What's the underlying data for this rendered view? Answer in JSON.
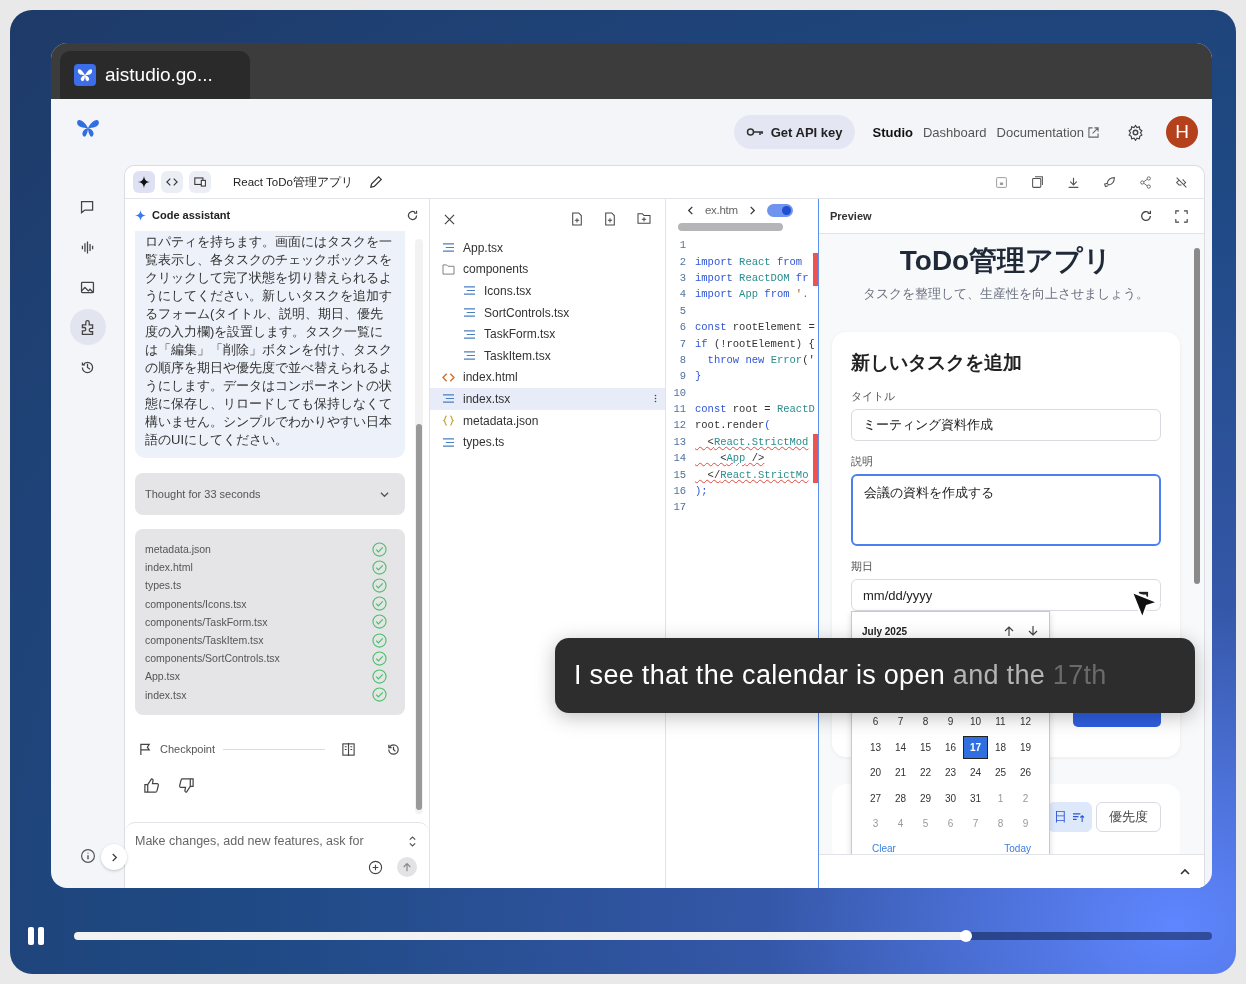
{
  "player": {
    "playing": true,
    "level": 0.784
  },
  "browser_tab": {
    "title": "aistudio.go..."
  },
  "header": {
    "api_key_button": "Get API key",
    "nav": [
      {
        "label": "Studio",
        "selected": true,
        "external": false
      },
      {
        "label": "Dashboard",
        "selected": false,
        "external": false
      },
      {
        "label": "Documentation",
        "selected": false,
        "external": true
      }
    ],
    "avatar": "H"
  },
  "rail": {
    "items": [
      {
        "kind": "chat",
        "selected": false
      },
      {
        "kind": "audio",
        "selected": false
      },
      {
        "kind": "image",
        "selected": false
      },
      {
        "kind": "build",
        "selected": true
      },
      {
        "kind": "history",
        "selected": false
      }
    ]
  },
  "project": {
    "title": "React ToDo管理アプリ",
    "modes": [
      {
        "kind": "assistant",
        "selected": true
      },
      {
        "kind": "code",
        "selected": false
      },
      {
        "kind": "device",
        "selected": false
      }
    ]
  },
  "chat": {
    "title": "Code assistant",
    "message": "ロパティを持ちます。画面にはタスクを一覧表示し、各タスクのチェックボックスをクリックして完了状態を切り替えられるようにしてください。新しいタスクを追加するフォーム(タイトル、説明、期日、優先度の入力欄)を設置します。タスク一覧には「編集」「削除」ボタンを付け、タスクの順序を期日や優先度で並べ替えられるようにします。データはコンポーネントの状態に保存し、リロードしても保持しなくて構いません。シンプルでわかりやすい日本語のUIにしてください。",
    "thought": {
      "label": "Thought for 33 seconds",
      "expanded": false
    },
    "files": [
      {
        "name": "metadata.json",
        "done": true
      },
      {
        "name": "index.html",
        "done": true
      },
      {
        "name": "types.ts",
        "done": true
      },
      {
        "name": "components/Icons.tsx",
        "done": true
      },
      {
        "name": "components/TaskForm.tsx",
        "done": true
      },
      {
        "name": "components/TaskItem.tsx",
        "done": true
      },
      {
        "name": "components/SortControls.tsx",
        "done": true
      },
      {
        "name": "App.tsx",
        "done": true
      },
      {
        "name": "index.tsx",
        "done": true
      }
    ],
    "checkpoint": "Checkpoint",
    "input": {
      "placeholder": "Make changes, add new features, ask for"
    }
  },
  "files": {
    "tree": [
      {
        "name": "App.tsx",
        "kind": "code",
        "selected": false
      },
      {
        "name": "components",
        "kind": "folder",
        "selected": false,
        "children": [
          {
            "name": "Icons.tsx",
            "kind": "code",
            "selected": false
          },
          {
            "name": "SortControls.tsx",
            "kind": "code",
            "selected": false
          },
          {
            "name": "TaskForm.tsx",
            "kind": "code",
            "selected": false
          },
          {
            "name": "TaskItem.tsx",
            "kind": "code",
            "selected": false
          }
        ]
      },
      {
        "name": "index.html",
        "kind": "html",
        "selected": false
      },
      {
        "name": "index.tsx",
        "kind": "code",
        "selected": true
      },
      {
        "name": "metadata.json",
        "kind": "json",
        "selected": false
      },
      {
        "name": "types.ts",
        "kind": "code",
        "selected": false
      }
    ]
  },
  "editor": {
    "tab": "ex.htm",
    "toggle_on": true,
    "lines": [
      {
        "number": "1"
      },
      {
        "number": "2",
        "marker": true,
        "tokens": [
          {
            "t": "import",
            "kind": "keyword"
          },
          {
            "t": " React ",
            "kind": "name"
          },
          {
            "t": "from",
            "kind": "keyword"
          }
        ]
      },
      {
        "number": "3",
        "marker": true,
        "tokens": [
          {
            "t": "import",
            "kind": "keyword"
          },
          {
            "t": " ReactDOM ",
            "kind": "name"
          },
          {
            "t": "fr",
            "kind": "keyword"
          }
        ]
      },
      {
        "number": "4",
        "tokens": [
          {
            "t": "import",
            "kind": "keyword"
          },
          {
            "t": " App ",
            "kind": "name"
          },
          {
            "t": "from",
            "kind": "keyword"
          },
          {
            "t": " '.",
            "kind": "string"
          }
        ]
      },
      {
        "number": "5"
      },
      {
        "number": "6",
        "tokens": [
          {
            "t": "const",
            "kind": "keyword"
          },
          {
            "t": " rootElement =",
            "kind": "plain"
          }
        ]
      },
      {
        "number": "7",
        "tokens": [
          {
            "t": "if",
            "kind": "keyword"
          },
          {
            "t": " (!rootElement) {",
            "kind": "plain"
          }
        ]
      },
      {
        "number": "8",
        "tokens": [
          {
            "t": "  throw new ",
            "kind": "keyword"
          },
          {
            "t": "Error",
            "kind": "name"
          },
          {
            "t": "('",
            "kind": "plain"
          }
        ]
      },
      {
        "number": "9",
        "tokens": [
          {
            "t": "}",
            "kind": "keyword"
          }
        ]
      },
      {
        "number": "10"
      },
      {
        "number": "11",
        "tokens": [
          {
            "t": "const",
            "kind": "keyword"
          },
          {
            "t": " root = ",
            "kind": "plain"
          },
          {
            "t": "ReactD",
            "kind": "name"
          }
        ]
      },
      {
        "number": "12",
        "tokens": [
          {
            "t": "root.render",
            "kind": "plain"
          },
          {
            "t": "(",
            "kind": "keyword"
          }
        ]
      },
      {
        "number": "13",
        "marker": true,
        "squiggle": true,
        "tokens": [
          {
            "t": "  <",
            "kind": "plain"
          },
          {
            "t": "React.StrictMod",
            "kind": "name"
          }
        ]
      },
      {
        "number": "14",
        "marker": true,
        "squiggle": true,
        "tokens": [
          {
            "t": "    <",
            "kind": "plain"
          },
          {
            "t": "App",
            "kind": "name"
          },
          {
            "t": " />",
            "kind": "plain"
          }
        ]
      },
      {
        "number": "15",
        "marker": true,
        "squiggle": true,
        "tokens": [
          {
            "t": "  </",
            "kind": "plain"
          },
          {
            "t": "React.StrictMo",
            "kind": "name"
          }
        ]
      },
      {
        "number": "16",
        "tokens": [
          {
            "t": ");",
            "kind": "keyword"
          }
        ]
      },
      {
        "number": "17"
      }
    ]
  },
  "preview": {
    "title": "Preview",
    "app_title": "ToDo管理アプリ",
    "subtitle": "タスクを整理して、生産性を向上させましょう。",
    "form": {
      "heading": "新しいタスクを追加",
      "fields": [
        {
          "label": "タイトル",
          "kind": "text",
          "value": "ミーティング資料作成",
          "focused": false
        },
        {
          "label": "説明",
          "kind": "textarea",
          "value": "会議の資料を作成する",
          "focused": true
        },
        {
          "label": "期日",
          "kind": "date",
          "placeholder": "mm/dd/yyyy",
          "focused": false
        }
      ]
    },
    "sort_buttons": [
      {
        "label": "日",
        "selected": true
      },
      {
        "label": "優先度",
        "selected": false
      }
    ],
    "calendar": {
      "month": "July 2025",
      "weeks": [
        [
          {
            "day": "6",
            "outside": false,
            "selected": false
          },
          {
            "day": "7",
            "outside": false,
            "selected": false
          },
          {
            "day": "8",
            "outside": false,
            "selected": false
          },
          {
            "day": "9",
            "outside": false,
            "selected": false
          },
          {
            "day": "10",
            "outside": false,
            "selected": false
          },
          {
            "day": "11",
            "outside": false,
            "selected": false
          },
          {
            "day": "12",
            "outside": false,
            "selected": false
          }
        ],
        [
          {
            "day": "13",
            "outside": false,
            "selected": false
          },
          {
            "day": "14",
            "outside": false,
            "selected": false
          },
          {
            "day": "15",
            "outside": false,
            "selected": false
          },
          {
            "day": "16",
            "outside": false,
            "selected": false
          },
          {
            "day": "17",
            "outside": false,
            "selected": true
          },
          {
            "day": "18",
            "outside": false,
            "selected": false
          },
          {
            "day": "19",
            "outside": false,
            "selected": false
          }
        ],
        [
          {
            "day": "20",
            "outside": false,
            "selected": false
          },
          {
            "day": "21",
            "outside": false,
            "selected": false
          },
          {
            "day": "22",
            "outside": false,
            "selected": false
          },
          {
            "day": "23",
            "outside": false,
            "selected": false
          },
          {
            "day": "24",
            "outside": false,
            "selected": false
          },
          {
            "day": "25",
            "outside": false,
            "selected": false
          },
          {
            "day": "26",
            "outside": false,
            "selected": false
          }
        ],
        [
          {
            "day": "27",
            "outside": false,
            "selected": false
          },
          {
            "day": "28",
            "outside": false,
            "selected": false
          },
          {
            "day": "29",
            "outside": false,
            "selected": false
          },
          {
            "day": "30",
            "outside": false,
            "selected": false
          },
          {
            "day": "31",
            "outside": false,
            "selected": false
          },
          {
            "day": "1",
            "outside": true,
            "selected": false
          },
          {
            "day": "2",
            "outside": true,
            "selected": false
          }
        ],
        [
          {
            "day": "3",
            "outside": true,
            "selected": false
          },
          {
            "day": "4",
            "outside": true,
            "selected": false
          },
          {
            "day": "5",
            "outside": true,
            "selected": false
          },
          {
            "day": "6",
            "outside": true,
            "selected": false
          },
          {
            "day": "7",
            "outside": true,
            "selected": false
          },
          {
            "day": "8",
            "outside": true,
            "selected": false
          },
          {
            "day": "9",
            "outside": true,
            "selected": false
          }
        ]
      ],
      "clear": "Clear",
      "today": "Today"
    }
  },
  "caption": {
    "segments": [
      {
        "text": "I see that the calendar is open",
        "kind": "spoken"
      },
      {
        "text": "and the",
        "kind": "fading"
      },
      {
        "text": "17th",
        "kind": "pending"
      }
    ]
  }
}
